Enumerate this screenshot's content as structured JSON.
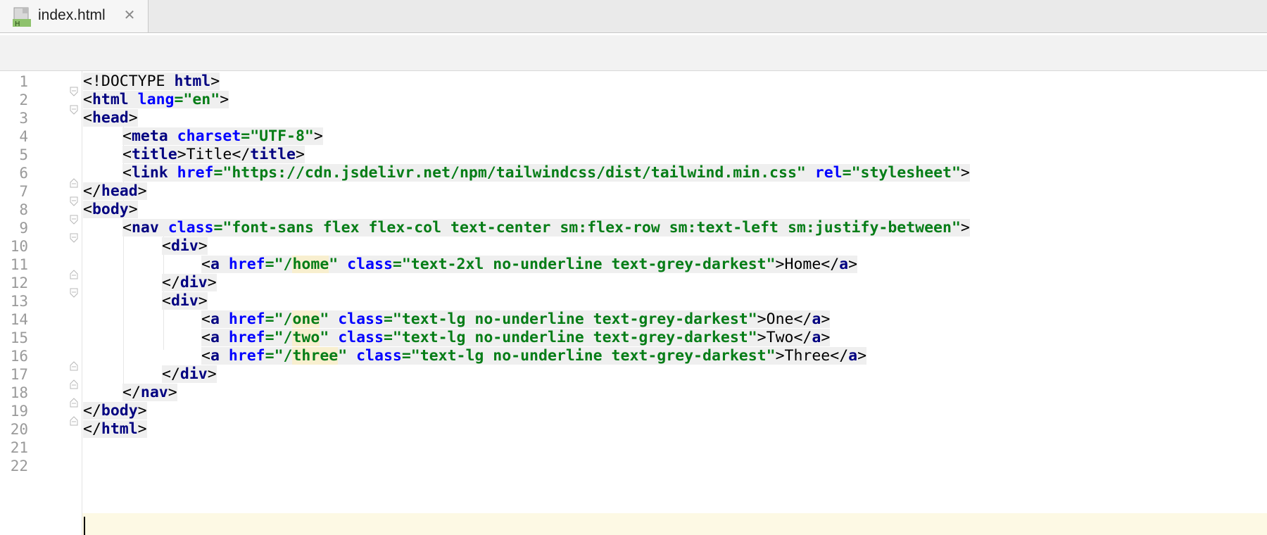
{
  "tab": {
    "filename": "index.html",
    "icon": "html-file-icon",
    "close_glyph": "✕"
  },
  "code": {
    "line_numbers": [
      "1",
      "2",
      "3",
      "4",
      "5",
      "6",
      "7",
      "8",
      "9",
      "10",
      "11",
      "12",
      "13",
      "14",
      "15",
      "16",
      "17",
      "18",
      "19",
      "20",
      "21",
      "22"
    ],
    "l1": {
      "a": "<!DOCTYPE ",
      "b": "html",
      "c": ">"
    },
    "l2": {
      "a": "<",
      "b": "html",
      "c": " lang",
      "d": "=\"en\"",
      "e": ">"
    },
    "l3": {
      "a": "<",
      "b": "head",
      "c": ">"
    },
    "l4": {
      "a": "<",
      "b": "meta",
      "c": " charset",
      "d": "=\"UTF-8\"",
      "e": ">"
    },
    "l5": {
      "a": "<",
      "b": "title",
      "c": ">",
      "d": "Title",
      "e": "</",
      "f": "title",
      "g": ">"
    },
    "l6": {
      "a": "<",
      "b": "link",
      "c": " href",
      "d": "=\"https://cdn.jsdelivr.net/npm/tailwindcss/dist/tailwind.min.css\"",
      "e": " rel",
      "f": "=\"stylesheet\"",
      "g": ">"
    },
    "l7": {
      "a": "</",
      "b": "head",
      "c": ">"
    },
    "l8": {
      "a": "<",
      "b": "body",
      "c": ">"
    },
    "l9": {
      "a": "<",
      "b": "nav",
      "c": " class",
      "d": "=\"font-sans flex flex-col text-center sm:flex-row sm:text-left sm:justify-between\"",
      "e": ">"
    },
    "l10": {
      "a": "<",
      "b": "div",
      "c": ">"
    },
    "l11": {
      "a": "<",
      "b": "a",
      "c": " href",
      "d1": "=\"/",
      "d2": "home",
      "d3": "\"",
      "e": " class",
      "f": "=\"text-2xl no-underline text-grey-darkest\"",
      "g": ">",
      "h": "Home",
      "i": "</",
      "j": "a",
      "k": ">"
    },
    "l12": {
      "a": "</",
      "b": "div",
      "c": ">"
    },
    "l13": {
      "a": "<",
      "b": "div",
      "c": ">"
    },
    "l14": {
      "a": "<",
      "b": "a",
      "c": " href",
      "d1": "=\"/",
      "d2": "one",
      "d3": "\"",
      "e": " class",
      "f": "=\"text-lg no-underline text-grey-darkest\"",
      "g": ">",
      "h": "One",
      "i": "</",
      "j": "a",
      "k": ">"
    },
    "l15": {
      "a": "<",
      "b": "a",
      "c": " href",
      "d1": "=\"/",
      "d2": "two",
      "d3": "\"",
      "e": " class",
      "f": "=\"text-lg no-underline text-grey-darkest\"",
      "g": ">",
      "h": "Two",
      "i": "</",
      "j": "a",
      "k": ">"
    },
    "l16": {
      "a": "<",
      "b": "a",
      "c": " href",
      "d1": "=\"/",
      "d2": "three",
      "d3": "\"",
      "e": " class",
      "f": "=\"text-lg no-underline text-grey-darkest\"",
      "g": ">",
      "h": "Three",
      "i": "</",
      "j": "a",
      "k": ">"
    },
    "l17": {
      "a": "</",
      "b": "div",
      "c": ">"
    },
    "l18": {
      "a": "</",
      "b": "nav",
      "c": ">"
    },
    "l19": {
      "a": "</",
      "b": "body",
      "c": ">"
    },
    "l20": {
      "a": "</",
      "b": "html",
      "c": ">"
    }
  },
  "colors": {
    "tag": "#000080",
    "attribute": "#0000ff",
    "value": "#067d17",
    "caret_line": "#fdf9e4"
  }
}
